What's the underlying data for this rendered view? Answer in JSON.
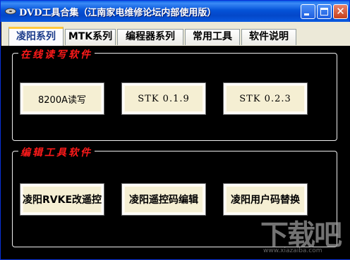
{
  "window": {
    "title": "DVD工具合集（江南家电维修论坛内部使用版）",
    "controls": {
      "minimize": "",
      "maximize": "",
      "close": "✕"
    }
  },
  "tabs": [
    {
      "label": "凌阳系列",
      "active": true
    },
    {
      "label": "MTK系列",
      "active": false
    },
    {
      "label": "编程器系列",
      "active": false
    },
    {
      "label": "常用工具",
      "active": false
    },
    {
      "label": "软件说明",
      "active": false
    }
  ],
  "groups": {
    "online": {
      "title": "在线读写软件",
      "buttons": [
        "8200A读写",
        "STK 0.1.9",
        "STK 0.2.3"
      ]
    },
    "edit": {
      "title": "编辑工具软件",
      "buttons": [
        "凌阳RVKE改遥控",
        "凌阳遥控码编辑",
        "凌阳用户码替换"
      ]
    }
  },
  "watermark": {
    "main": "下载吧",
    "sub": "www.xiazaiba.com"
  },
  "colors": {
    "titlebar": "#0553d8",
    "group_title": "#ff1a1a",
    "button_face": "#f5efd3",
    "active_tab_accent": "#ffc83c"
  }
}
